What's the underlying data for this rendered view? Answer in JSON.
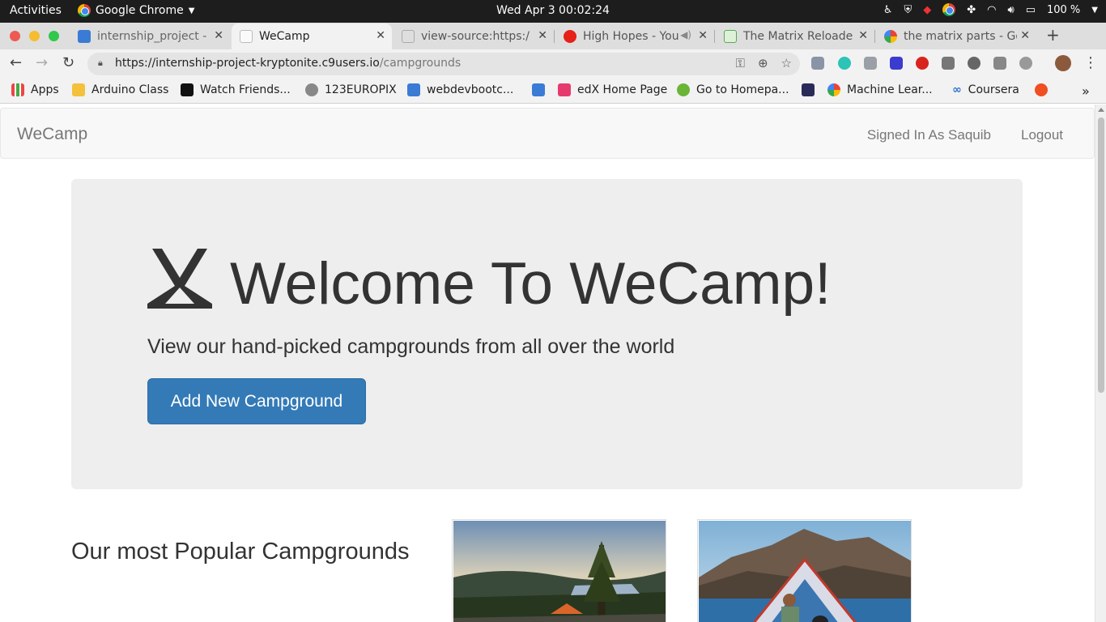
{
  "system": {
    "activities": "Activities",
    "app_name": "Google Chrome",
    "clock": "Wed Apr 3  00:02:24",
    "battery": "100 %"
  },
  "tabs": [
    {
      "label": "internship_project -",
      "active": false
    },
    {
      "label": "WeCamp",
      "active": true
    },
    {
      "label": "view-source:https:/",
      "active": false
    },
    {
      "label": "High Hopes - You",
      "active": false
    },
    {
      "label": "The Matrix Reloade",
      "active": false
    },
    {
      "label": "the matrix parts - Go",
      "active": false
    }
  ],
  "toolbar": {
    "url_host": "https://internship-project-kryptonite.c9users.io",
    "url_path": "/campgrounds"
  },
  "bookmarks": [
    {
      "label": "Apps"
    },
    {
      "label": "Arduino Class"
    },
    {
      "label": "Watch Friends..."
    },
    {
      "label": "123EUROPIX"
    },
    {
      "label": "webdevbootc..."
    },
    {
      "label": ""
    },
    {
      "label": "edX Home Page"
    },
    {
      "label": "Go to Homepa..."
    },
    {
      "label": ""
    },
    {
      "label": "Machine Lear..."
    },
    {
      "label": "Coursera"
    }
  ],
  "page": {
    "brand": "WeCamp",
    "nav_signed_in": "Signed In As Saquib",
    "nav_logout": "Logout",
    "title": "Welcome To WeCamp!",
    "lead": "View our hand-picked campgrounds from all over the world",
    "add_button": "Add New Campground",
    "popular_heading": "Our most Popular Campgrounds"
  },
  "colors": {
    "primary_button": "#337ab7",
    "jumbotron_bg": "#eeeeee",
    "navbar_bg": "#f8f8f8"
  }
}
